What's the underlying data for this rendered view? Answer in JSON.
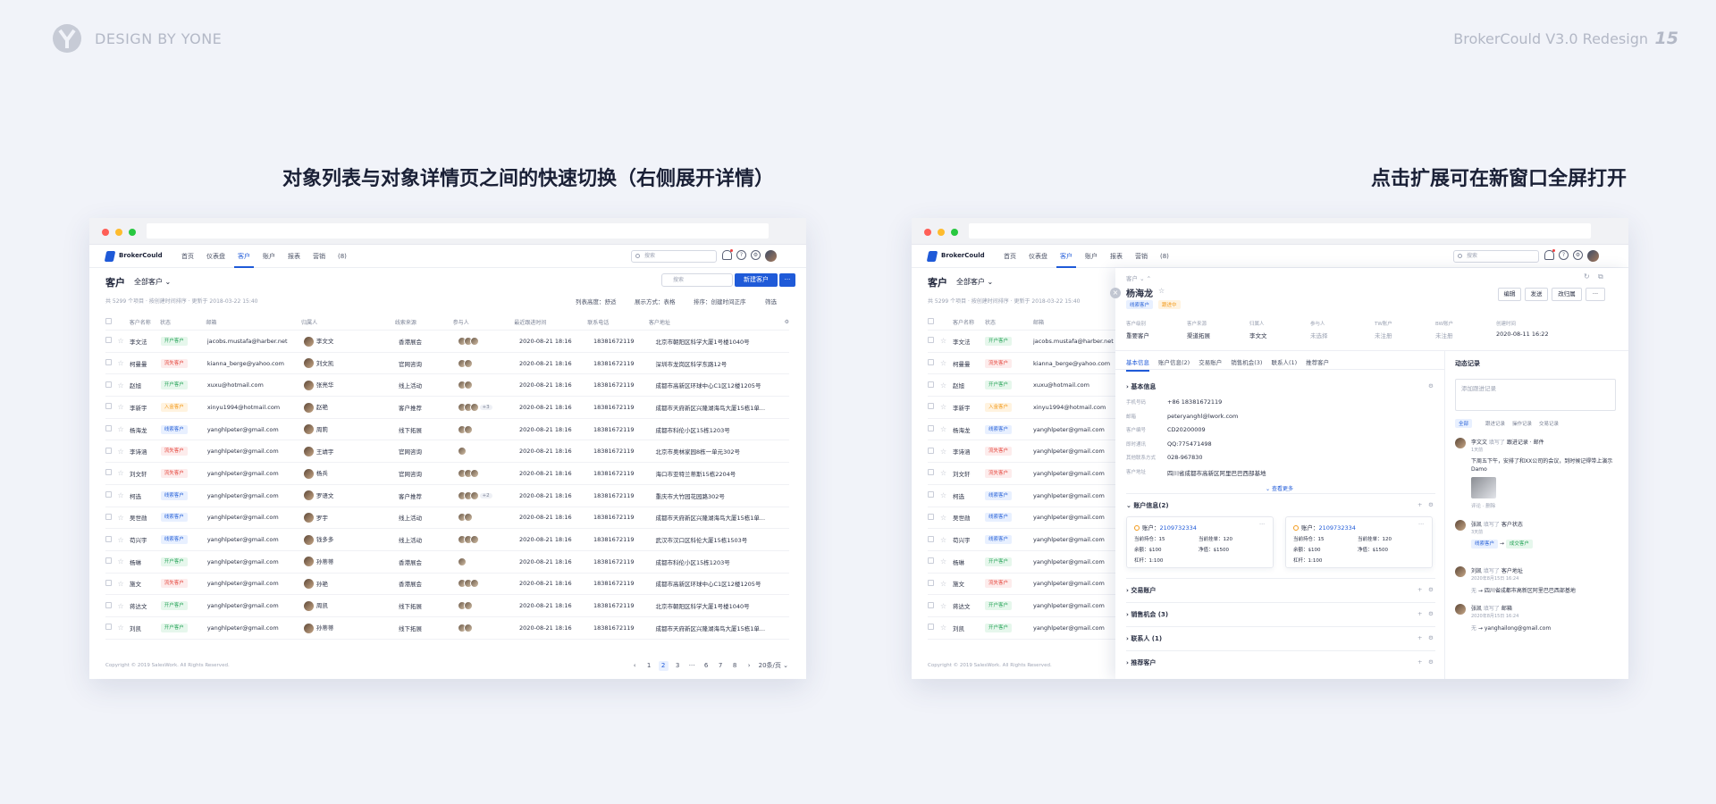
{
  "slide": {
    "brand": "DESIGN BY YONE",
    "deck_title": "BrokerCould V3.0 Redesign",
    "page_number": "15",
    "caption_left": "对象列表与对象详情页之间的快速切换（右侧展开详情）",
    "caption_right": "点击扩展可在新窗口全屏打开"
  },
  "app": {
    "brand": "BrokerCould",
    "nav": [
      "首页",
      "仪表盘",
      "客户",
      "账户",
      "报表",
      "营销",
      "(8)"
    ],
    "nav_active": "客户",
    "search_placeholder": "搜索",
    "page_title": "客户",
    "view_name": "全部客户",
    "meta": "共 5299 个项目 · 按创建时间排序 · 更新于 2018-03-22 15:40",
    "list_search_placeholder": "搜索",
    "new_button": "新建客户",
    "more_button": "···",
    "controls": {
      "row_height": "列表高度：舒适",
      "display_mode": "展示方式：表格",
      "sort": "排序：创建时间正序",
      "filter": "筛选"
    },
    "columns": [
      "客户名称",
      "状态",
      "邮箱",
      "归属人",
      "线索来源",
      "参与人",
      "最近跟进时间",
      "联系电话",
      "客户地址"
    ],
    "rows": [
      {
        "name": "李文法",
        "status": "开户客户",
        "status_color": "green",
        "email": "jacobs.mustafa@harber.net",
        "owner": "李文文",
        "source": "香港展会",
        "participants": 3,
        "extra": "",
        "time": "2020-08-21 18:16",
        "phone": "18381672119",
        "address": "北京市朝阳区科学大厦1号楼1040号"
      },
      {
        "name": "柯曼曼",
        "status": "流失客户",
        "status_color": "red",
        "email": "kianna_berge@yahoo.com",
        "owner": "刘文凯",
        "source": "官网咨询",
        "participants": 2,
        "extra": "",
        "time": "2020-08-21 18:16",
        "phone": "18381672119",
        "address": "深圳市龙岗区科学东路12号"
      },
      {
        "name": "赵旭",
        "status": "开户客户",
        "status_color": "green",
        "email": "xuxu@hotmail.com",
        "owner": "张亮华",
        "source": "线上活动",
        "participants": 2,
        "extra": "",
        "time": "2020-08-21 18:16",
        "phone": "18381672119",
        "address": "成都市高新区环球中心C1区12楼1205号"
      },
      {
        "name": "李新宇",
        "status": "入金客户",
        "status_color": "orange",
        "email": "xinyu1994@hotmail.com",
        "owner": "赵艳",
        "source": "客户推荐",
        "participants": 3,
        "extra": "+3",
        "time": "2020-08-21 18:16",
        "phone": "18381672119",
        "address": "成都市天府新区兴隆湖海鸟大厦15栋1单..."
      },
      {
        "name": "杨海龙",
        "status": "线索客户",
        "status_color": "blue",
        "email": "yanghlpeter@gmail.com",
        "owner": "周莉",
        "source": "线下拓展",
        "participants": 2,
        "extra": "",
        "time": "2020-08-21 18:16",
        "phone": "18381672119",
        "address": "成都市科伦小区15栋1203号"
      },
      {
        "name": "李诗涵",
        "status": "流失客户",
        "status_color": "red",
        "email": "yanghlpeter@gmail.com",
        "owner": "王靖宇",
        "source": "官网咨询",
        "participants": 1,
        "extra": "",
        "time": "2020-08-21 18:16",
        "phone": "18381672119",
        "address": "北京市奥林家园8栋一单元302号"
      },
      {
        "name": "刘文轩",
        "status": "流失客户",
        "status_color": "red",
        "email": "yanghlpeter@gmail.com",
        "owner": "杨兵",
        "source": "官网咨询",
        "participants": 3,
        "extra": "",
        "time": "2020-08-21 18:16",
        "phone": "18381672119",
        "address": "海口市亚特兰蒂斯15栋2204号"
      },
      {
        "name": "柯选",
        "status": "线索客户",
        "status_color": "blue",
        "email": "yanghlpeter@gmail.com",
        "owner": "罗语文",
        "source": "客户推荐",
        "participants": 3,
        "extra": "+2",
        "time": "2020-08-21 18:16",
        "phone": "18381672119",
        "address": "重庆市大竹园花园路302号"
      },
      {
        "name": "吴世勋",
        "status": "线索客户",
        "status_color": "blue",
        "email": "yanghlpeter@gmail.com",
        "owner": "罗宇",
        "source": "线上活动",
        "participants": 2,
        "extra": "",
        "time": "2020-08-21 18:16",
        "phone": "18381672119",
        "address": "成都市天府新区兴隆湖海鸟大厦15栋1单..."
      },
      {
        "name": "苟兴宇",
        "status": "线索客户",
        "status_color": "blue",
        "email": "yanghlpeter@gmail.com",
        "owner": "钱多多",
        "source": "线上活动",
        "participants": 3,
        "extra": "",
        "time": "2020-08-21 18:16",
        "phone": "18381672119",
        "address": "武汉市汉口区科伦大厦15栋1503号"
      },
      {
        "name": "杨琳",
        "status": "开户客户",
        "status_color": "green",
        "email": "yanghlpeter@gmail.com",
        "owner": "孙蒂蒂",
        "source": "香港展会",
        "participants": 1,
        "extra": "",
        "time": "2020-08-21 18:16",
        "phone": "18381672119",
        "address": "成都市科伦小区15栋1203号"
      },
      {
        "name": "施文",
        "status": "流失客户",
        "status_color": "red",
        "email": "yanghlpeter@gmail.com",
        "owner": "孙艳",
        "source": "香港展会",
        "participants": 3,
        "extra": "",
        "time": "2020-08-21 18:16",
        "phone": "18381672119",
        "address": "成都市高新区环球中心C1区12楼1205号"
      },
      {
        "name": "蒋达文",
        "status": "开户客户",
        "status_color": "green",
        "email": "yanghlpeter@gmail.com",
        "owner": "周凯",
        "source": "线下拓展",
        "participants": 2,
        "extra": "",
        "time": "2020-08-21 18:16",
        "phone": "18381672119",
        "address": "北京市朝阳区科学大厦1号楼1040号"
      },
      {
        "name": "刘凯",
        "status": "开户客户",
        "status_color": "green",
        "email": "yanghlpeter@gmail.com",
        "owner": "孙蒂蒂",
        "source": "线下拓展",
        "participants": 2,
        "extra": "",
        "time": "2020-08-21 18:16",
        "phone": "18381672119",
        "address": "成都市天府新区兴隆湖海鸟大厦15栋1单..."
      }
    ],
    "footer": "Copyright © 2019 SalesWork. All Rights Reserved.",
    "pager": {
      "prev": "‹",
      "pages": [
        "1",
        "2",
        "3",
        "···",
        "6",
        "7",
        "8"
      ],
      "current": "2",
      "next": "›",
      "page_size": "20条/页"
    }
  },
  "detail": {
    "breadcrumb": "客户",
    "name": "杨海龙",
    "tags": [
      "线索客户",
      "跟进中"
    ],
    "actions": [
      "编辑",
      "发送",
      "改归属",
      "···"
    ],
    "fields": [
      {
        "label": "客户级别",
        "value": "重要客户"
      },
      {
        "label": "客户来源",
        "value": "渠道拓展"
      },
      {
        "label": "归属人",
        "value": "李文文"
      },
      {
        "label": "参与人",
        "value": "未选择"
      },
      {
        "label": "TW账户",
        "value": "未注册"
      },
      {
        "label": "BW账户",
        "value": "未注册"
      },
      {
        "label": "创建时间",
        "value": "2020-08-11 16:22"
      }
    ],
    "tabs": [
      "基本信息",
      "账户信息(2)",
      "交易账户",
      "销售机会(3)",
      "联系人(1)",
      "推荐客户"
    ],
    "active_tab": "基本信息",
    "basic_title": "基本信息",
    "basic": [
      {
        "label": "手机号码",
        "value": "+86 18381672119"
      },
      {
        "label": "邮箱",
        "value": "peteryanghl@lwork.com"
      },
      {
        "label": "客户编号",
        "value": "CD20200009"
      },
      {
        "label": "即时通讯",
        "value": "QQ:775471498"
      },
      {
        "label": "其他联系方式",
        "value": "028-967830"
      },
      {
        "label": "客户地址",
        "value": "四川省成都市高新区阿里巴巴西部基地"
      }
    ],
    "show_more": "查看更多",
    "accounts_title": "账户信息(2)",
    "accounts": [
      {
        "label": "账户：",
        "number": "2109732334",
        "k1": "当前持仓：",
        "v1": "15",
        "k2": "当前挂单：",
        "v2": "120",
        "k3": "余额：",
        "v3": "$100",
        "k4": "净值：",
        "v4": "$1500",
        "k5": "杠杆：",
        "v5": "1:100"
      },
      {
        "label": "账户：",
        "number": "2109732334",
        "k1": "当前持仓：",
        "v1": "15",
        "k2": "当前挂单：",
        "v2": "120",
        "k3": "余额：",
        "v3": "$100",
        "k4": "净值：",
        "v4": "$1500",
        "k5": "杠杆：",
        "v5": "1:100"
      }
    ],
    "sections": [
      "交易账户",
      "销售机会 (3)",
      "联系人 (1)",
      "推荐客户"
    ],
    "activity_title": "动态记录",
    "comment_placeholder": "添加跟进记录",
    "activity_filters": [
      "全部",
      "跟进记录",
      "操作记录",
      "交易记录"
    ],
    "activities": [
      {
        "who": "李文文",
        "verb": "填写了",
        "obj": "跟进记录 · 邮件",
        "time": "1天前",
        "body": "下周五下午，安排了和XX公司的会议，到时候记得带上演示Damo",
        "actions": "评论 · 删除"
      },
      {
        "who": "张凯",
        "verb": "填写了",
        "obj": "客户状态",
        "time": "3天前",
        "from": "线索客户",
        "to": "成交客户"
      },
      {
        "who": "刘凯",
        "verb": "填写了",
        "obj": "客户地址",
        "time": "2020年8月15日 16:24",
        "from": "无",
        "to": "四川省成都市高新区阿里巴巴西部基地"
      },
      {
        "who": "张凯",
        "verb": "填写了",
        "obj": "邮箱",
        "time": "2020年8月15日 16:24",
        "from": "无",
        "to": "yanghailong@gmail.com"
      }
    ]
  }
}
